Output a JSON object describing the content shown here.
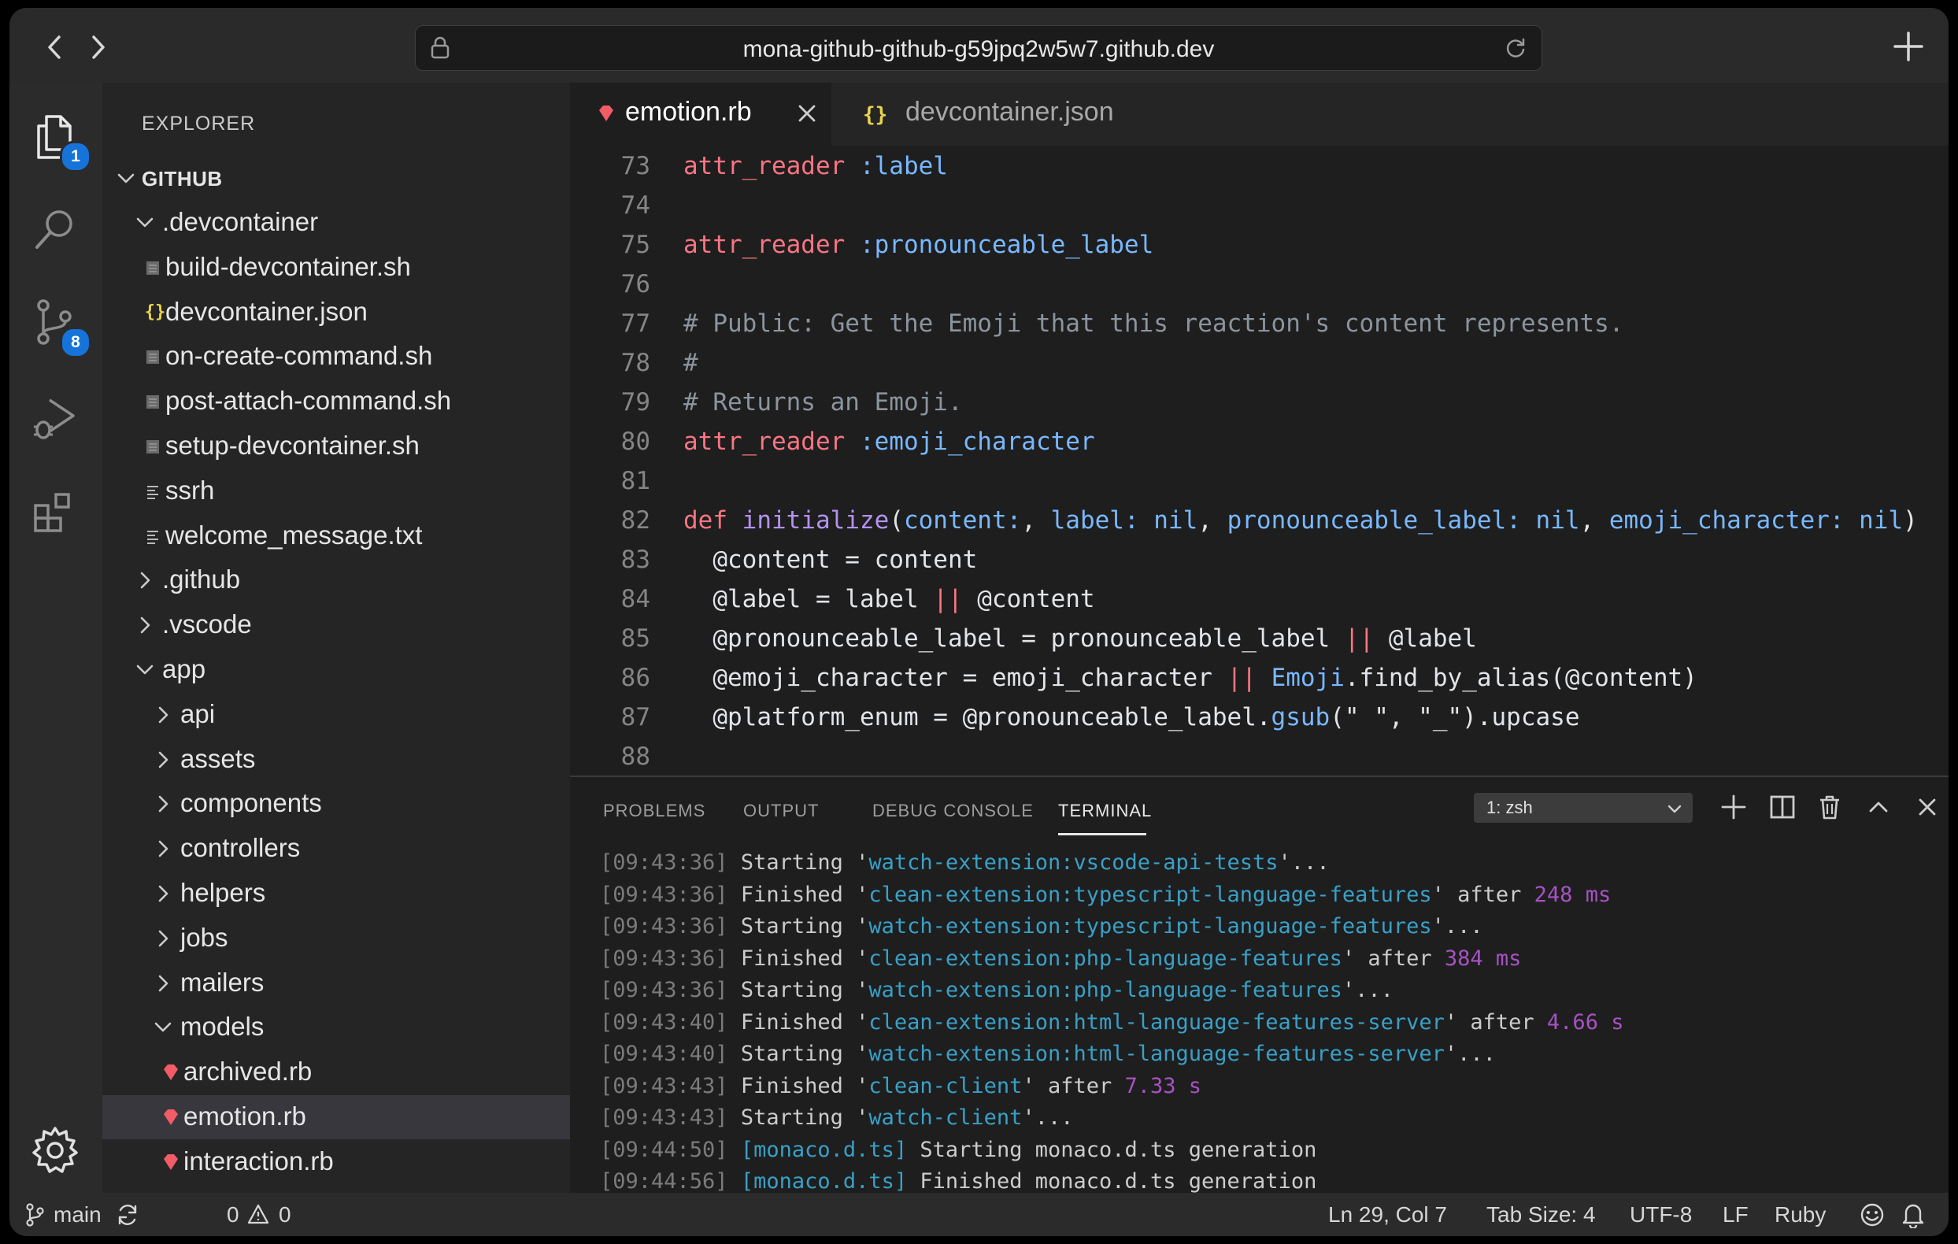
{
  "browser": {
    "url": "mona-github-github-g59jpq2w5w7.github.dev"
  },
  "activity_bar": {
    "explorer_badge": "1",
    "source_control_badge": "8"
  },
  "sidebar": {
    "title": "EXPLORER",
    "root": "GITHUB",
    "items": [
      {
        "label": ".devcontainer",
        "type": "folder",
        "expanded": true
      },
      {
        "label": "build-devcontainer.sh",
        "type": "file",
        "icon": "shell-file-icon"
      },
      {
        "label": "devcontainer.json",
        "type": "file",
        "icon": "json-file-icon"
      },
      {
        "label": "on-create-command.sh",
        "type": "file",
        "icon": "shell-file-icon"
      },
      {
        "label": "post-attach-command.sh",
        "type": "file",
        "icon": "shell-file-icon"
      },
      {
        "label": "setup-devcontainer.sh",
        "type": "file",
        "icon": "shell-file-icon"
      },
      {
        "label": "ssrh",
        "type": "file",
        "icon": "text-file-icon"
      },
      {
        "label": "welcome_message.txt",
        "type": "file",
        "icon": "text-file-icon"
      },
      {
        "label": ".github",
        "type": "folder",
        "expanded": false
      },
      {
        "label": ".vscode",
        "type": "folder",
        "expanded": false
      },
      {
        "label": "app",
        "type": "folder",
        "expanded": true
      },
      {
        "label": "api",
        "type": "folder",
        "expanded": false
      },
      {
        "label": "assets",
        "type": "folder",
        "expanded": false
      },
      {
        "label": "components",
        "type": "folder",
        "expanded": false
      },
      {
        "label": "controllers",
        "type": "folder",
        "expanded": false
      },
      {
        "label": "helpers",
        "type": "folder",
        "expanded": false
      },
      {
        "label": "jobs",
        "type": "folder",
        "expanded": false
      },
      {
        "label": "mailers",
        "type": "folder",
        "expanded": false
      },
      {
        "label": "models",
        "type": "folder",
        "expanded": true
      },
      {
        "label": "archived.rb",
        "type": "file",
        "icon": "ruby-file-icon"
      },
      {
        "label": "emotion.rb",
        "type": "file",
        "icon": "ruby-file-icon",
        "selected": true
      },
      {
        "label": "interaction.rb",
        "type": "file",
        "icon": "ruby-file-icon"
      }
    ]
  },
  "tabs": [
    {
      "label": "emotion.rb",
      "icon": "ruby-file-icon",
      "active": true
    },
    {
      "label": "devcontainer.json",
      "icon": "json-file-icon",
      "active": false
    }
  ],
  "code_lines": [
    {
      "n": "73",
      "tokens": [
        [
          "attr_reader",
          "kw"
        ],
        [
          " ",
          "p"
        ],
        [
          ":label",
          "sym"
        ]
      ]
    },
    {
      "n": "74",
      "tokens": []
    },
    {
      "n": "75",
      "tokens": [
        [
          "attr_reader",
          "kw"
        ],
        [
          " ",
          "p"
        ],
        [
          ":pronounceable_label",
          "sym"
        ]
      ]
    },
    {
      "n": "76",
      "tokens": []
    },
    {
      "n": "77",
      "tokens": [
        [
          "# Public: Get the Emoji that this reaction's content represents.",
          "cm"
        ]
      ]
    },
    {
      "n": "78",
      "tokens": [
        [
          "#",
          "cm"
        ]
      ]
    },
    {
      "n": "79",
      "tokens": [
        [
          "# Returns an Emoji.",
          "cm"
        ]
      ]
    },
    {
      "n": "80",
      "tokens": [
        [
          "attr_reader",
          "kw"
        ],
        [
          " ",
          "p"
        ],
        [
          ":emoji_character",
          "sym"
        ]
      ]
    },
    {
      "n": "81",
      "tokens": []
    },
    {
      "n": "82",
      "tokens": [
        [
          "def",
          "kw"
        ],
        [
          " ",
          "p"
        ],
        [
          "initialize",
          "fn"
        ],
        [
          "(",
          "p"
        ],
        [
          "content:",
          "sym"
        ],
        [
          ", ",
          "p"
        ],
        [
          "label: nil",
          "sym"
        ],
        [
          ", ",
          "p"
        ],
        [
          "pronounceable_label: nil",
          "sym"
        ],
        [
          ", ",
          "p"
        ],
        [
          "emoji_character: nil",
          "sym"
        ],
        [
          ")",
          "p"
        ]
      ]
    },
    {
      "n": "83",
      "tokens": [
        [
          "  @content = content",
          "p"
        ]
      ]
    },
    {
      "n": "84",
      "tokens": [
        [
          "  @label = label ",
          "p"
        ],
        [
          "||",
          "kw"
        ],
        [
          " @content",
          "p"
        ]
      ]
    },
    {
      "n": "85",
      "tokens": [
        [
          "  @pronounceable_label = pronounceable_label ",
          "p"
        ],
        [
          "||",
          "kw"
        ],
        [
          " @label",
          "p"
        ]
      ]
    },
    {
      "n": "86",
      "tokens": [
        [
          "  @emoji_character = emoji_character ",
          "p"
        ],
        [
          "||",
          "kw"
        ],
        [
          " ",
          "p"
        ],
        [
          "Emoji",
          "sym"
        ],
        [
          ".find_by_alias(@content)",
          "p"
        ]
      ]
    },
    {
      "n": "87",
      "tokens": [
        [
          "  @platform_enum = @pronounceable_label.",
          "p"
        ],
        [
          "gsub",
          "sym"
        ],
        [
          "(\" \", \"_\").upcase",
          "p"
        ]
      ]
    },
    {
      "n": "88",
      "tokens": []
    }
  ],
  "panel": {
    "tabs": [
      "PROBLEMS",
      "OUTPUT",
      "DEBUG CONSOLE",
      "TERMINAL"
    ],
    "active_tab": "TERMINAL",
    "terminal_select": "1: zsh"
  },
  "terminal_lines": [
    {
      "time": "[09:43:36]",
      "tokens": [
        [
          " Starting '",
          "p"
        ],
        [
          "watch-extension:vscode-api-tests",
          "link"
        ],
        [
          "'...",
          "p"
        ]
      ]
    },
    {
      "time": "[09:43:36]",
      "tokens": [
        [
          " Finished '",
          "p"
        ],
        [
          "clean-extension:typescript-language-features",
          "link"
        ],
        [
          "' after ",
          "p"
        ],
        [
          "248 ms",
          "num"
        ]
      ]
    },
    {
      "time": "[09:43:36]",
      "tokens": [
        [
          " Starting '",
          "p"
        ],
        [
          "watch-extension:typescript-language-features",
          "link"
        ],
        [
          "'...",
          "p"
        ]
      ]
    },
    {
      "time": "[09:43:36]",
      "tokens": [
        [
          " Finished '",
          "p"
        ],
        [
          "clean-extension:php-language-features",
          "link"
        ],
        [
          "' after ",
          "p"
        ],
        [
          "384 ms",
          "num"
        ]
      ]
    },
    {
      "time": "[09:43:36]",
      "tokens": [
        [
          " Starting '",
          "p"
        ],
        [
          "watch-extension:php-language-features",
          "link"
        ],
        [
          "'...",
          "p"
        ]
      ]
    },
    {
      "time": "[09:43:40]",
      "tokens": [
        [
          " Finished '",
          "p"
        ],
        [
          "clean-extension:html-language-features-server",
          "link"
        ],
        [
          "' after ",
          "p"
        ],
        [
          "4.66 s",
          "num"
        ]
      ]
    },
    {
      "time": "[09:43:40]",
      "tokens": [
        [
          " Starting '",
          "p"
        ],
        [
          "watch-extension:html-language-features-server",
          "link"
        ],
        [
          "'...",
          "p"
        ]
      ]
    },
    {
      "time": "[09:43:43]",
      "tokens": [
        [
          " Finished '",
          "p"
        ],
        [
          "clean-client",
          "link"
        ],
        [
          "' after ",
          "p"
        ],
        [
          "7.33 s",
          "num"
        ]
      ]
    },
    {
      "time": "[09:43:43]",
      "tokens": [
        [
          " Starting '",
          "p"
        ],
        [
          "watch-client",
          "link"
        ],
        [
          "'...",
          "p"
        ]
      ]
    },
    {
      "time": "[09:44:50]",
      "tokens": [
        [
          " ",
          "p"
        ],
        [
          "[monaco.d.ts]",
          "link"
        ],
        [
          " Starting monaco.d.ts generation",
          "p"
        ]
      ]
    },
    {
      "time": "[09:44:56]",
      "tokens": [
        [
          " ",
          "p"
        ],
        [
          "[monaco.d.ts]",
          "link"
        ],
        [
          " Finished monaco.d.ts generation",
          "p"
        ]
      ]
    }
  ],
  "status_bar": {
    "branch": "main",
    "errors": "0",
    "warnings": "0",
    "position": "Ln 29, Col 7",
    "tab_size": "Tab Size: 4",
    "encoding": "UTF-8",
    "eol": "LF",
    "language": "Ruby"
  },
  "colors": {
    "keyword": "#f97583",
    "symbol": "#79b8ff",
    "function": "#b392f0",
    "comment": "#8b949e",
    "plain": "#e1e4e8",
    "term_link": "#39a0c7",
    "term_num": "#a752c3",
    "term_time": "#7b7b7b",
    "ruby_icon": "#f25c66",
    "json_icon": "#e8d44d",
    "badge": "#1673d9"
  }
}
